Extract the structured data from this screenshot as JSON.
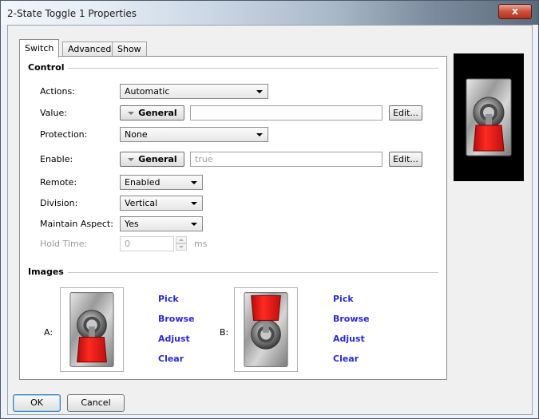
{
  "window": {
    "title": "2-State Toggle 1 Properties",
    "close_label": "x"
  },
  "tabs": [
    {
      "label": "Switch",
      "active": true
    },
    {
      "label": "Advanced",
      "active": false
    },
    {
      "label": "Show",
      "active": false
    }
  ],
  "control": {
    "heading": "Control",
    "actions": {
      "label": "Actions:",
      "value": "Automatic"
    },
    "value": {
      "label": "Value:",
      "type": "General",
      "text": "",
      "edit": "Edit..."
    },
    "protection": {
      "label": "Protection:",
      "value": "None"
    },
    "enable": {
      "label": "Enable:",
      "type": "General",
      "text": "true",
      "edit": "Edit..."
    },
    "remote": {
      "label": "Remote:",
      "value": "Enabled"
    },
    "division": {
      "label": "Division:",
      "value": "Vertical"
    },
    "maintain_aspect": {
      "label": "Maintain Aspect:",
      "value": "Yes"
    },
    "hold_time": {
      "label": "Hold Time:",
      "value": "0",
      "unit": "ms"
    }
  },
  "images": {
    "heading": "Images",
    "a": {
      "label": "A:",
      "state": "down"
    },
    "b": {
      "label": "B:",
      "state": "up"
    },
    "links": {
      "pick": "Pick",
      "browse": "Browse",
      "adjust": "Adjust",
      "clear": "Clear"
    }
  },
  "buttons": {
    "ok": "OK",
    "cancel": "Cancel"
  },
  "colors": {
    "link": "#2a2ad8",
    "toggle_red": "#e0201a",
    "preview_bg": "#000000"
  },
  "icons": {
    "toggle_switch": "toggle-switch-icon"
  }
}
